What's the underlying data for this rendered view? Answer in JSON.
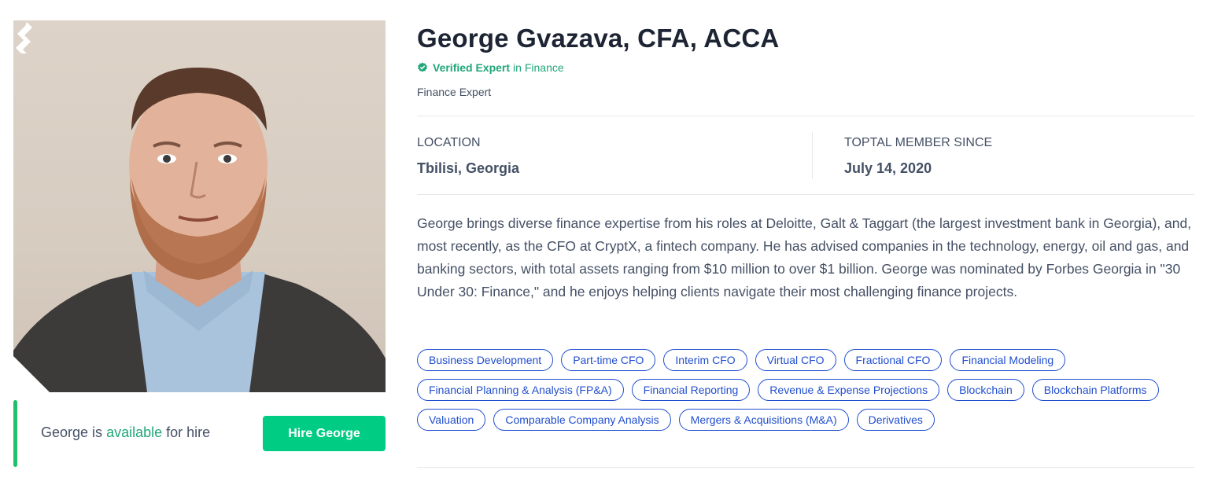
{
  "profile": {
    "name": "George Gvazava, CFA, ACCA",
    "verified_label": "Verified Expert",
    "verified_suffix": "in Finance",
    "role": "Finance Expert",
    "location_label": "LOCATION",
    "location_value": "Tbilisi, Georgia",
    "member_label": "TOPTAL MEMBER SINCE",
    "member_value": "July 14, 2020",
    "bio": "George brings diverse finance expertise from his roles at Deloitte, Galt & Taggart (the largest investment bank in Georgia), and, most recently, as the CFO at CryptX, a fintech company. He has advised companies in the technology, energy, oil and gas, and banking sectors, with total assets ranging from $10 million to over $1 billion. George was nominated by Forbes Georgia in \"30 Under 30: Finance,\" and he enjoys helping clients navigate their most challenging finance projects."
  },
  "availability": {
    "prefix": "George is",
    "status": "available",
    "suffix": "for hire",
    "button_label": "Hire George"
  },
  "skills": [
    [
      "Business Development",
      "Part-time CFO",
      "Interim CFO",
      "Virtual CFO",
      "Fractional CFO",
      "Financial Modeling"
    ],
    [
      "Financial Planning & Analysis (FP&A)",
      "Financial Reporting",
      "Revenue & Expense Projections",
      "Blockchain",
      "Blockchain Platforms"
    ],
    [
      "Valuation",
      "Comparable Company Analysis",
      "Mergers & Acquisitions (M&A)",
      "Derivatives"
    ]
  ],
  "icons": {
    "verified": "verified-badge-icon",
    "brand": "toptal-logo-icon"
  },
  "colors": {
    "accent_green": "#00cc83",
    "verified_green": "#20a67a",
    "skill_blue": "#204ecf",
    "text": "#455065"
  }
}
